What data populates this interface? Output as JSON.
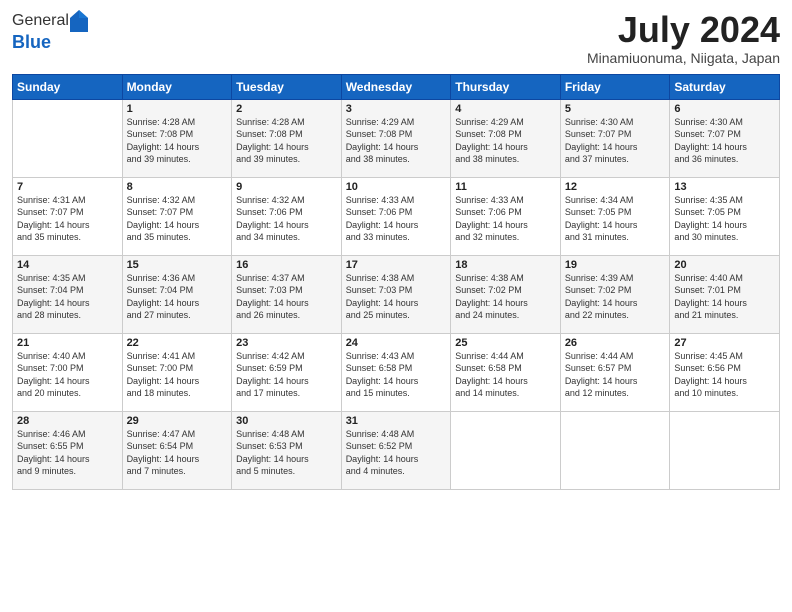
{
  "header": {
    "logo_general": "General",
    "logo_blue": "Blue",
    "month_title": "July 2024",
    "location": "Minamiuonuma, Niigata, Japan"
  },
  "weekdays": [
    "Sunday",
    "Monday",
    "Tuesday",
    "Wednesday",
    "Thursday",
    "Friday",
    "Saturday"
  ],
  "weeks": [
    [
      {
        "day": "",
        "info": ""
      },
      {
        "day": "1",
        "info": "Sunrise: 4:28 AM\nSunset: 7:08 PM\nDaylight: 14 hours\nand 39 minutes."
      },
      {
        "day": "2",
        "info": "Sunrise: 4:28 AM\nSunset: 7:08 PM\nDaylight: 14 hours\nand 39 minutes."
      },
      {
        "day": "3",
        "info": "Sunrise: 4:29 AM\nSunset: 7:08 PM\nDaylight: 14 hours\nand 38 minutes."
      },
      {
        "day": "4",
        "info": "Sunrise: 4:29 AM\nSunset: 7:08 PM\nDaylight: 14 hours\nand 38 minutes."
      },
      {
        "day": "5",
        "info": "Sunrise: 4:30 AM\nSunset: 7:07 PM\nDaylight: 14 hours\nand 37 minutes."
      },
      {
        "day": "6",
        "info": "Sunrise: 4:30 AM\nSunset: 7:07 PM\nDaylight: 14 hours\nand 36 minutes."
      }
    ],
    [
      {
        "day": "7",
        "info": "Sunrise: 4:31 AM\nSunset: 7:07 PM\nDaylight: 14 hours\nand 35 minutes."
      },
      {
        "day": "8",
        "info": "Sunrise: 4:32 AM\nSunset: 7:07 PM\nDaylight: 14 hours\nand 35 minutes."
      },
      {
        "day": "9",
        "info": "Sunrise: 4:32 AM\nSunset: 7:06 PM\nDaylight: 14 hours\nand 34 minutes."
      },
      {
        "day": "10",
        "info": "Sunrise: 4:33 AM\nSunset: 7:06 PM\nDaylight: 14 hours\nand 33 minutes."
      },
      {
        "day": "11",
        "info": "Sunrise: 4:33 AM\nSunset: 7:06 PM\nDaylight: 14 hours\nand 32 minutes."
      },
      {
        "day": "12",
        "info": "Sunrise: 4:34 AM\nSunset: 7:05 PM\nDaylight: 14 hours\nand 31 minutes."
      },
      {
        "day": "13",
        "info": "Sunrise: 4:35 AM\nSunset: 7:05 PM\nDaylight: 14 hours\nand 30 minutes."
      }
    ],
    [
      {
        "day": "14",
        "info": "Sunrise: 4:35 AM\nSunset: 7:04 PM\nDaylight: 14 hours\nand 28 minutes."
      },
      {
        "day": "15",
        "info": "Sunrise: 4:36 AM\nSunset: 7:04 PM\nDaylight: 14 hours\nand 27 minutes."
      },
      {
        "day": "16",
        "info": "Sunrise: 4:37 AM\nSunset: 7:03 PM\nDaylight: 14 hours\nand 26 minutes."
      },
      {
        "day": "17",
        "info": "Sunrise: 4:38 AM\nSunset: 7:03 PM\nDaylight: 14 hours\nand 25 minutes."
      },
      {
        "day": "18",
        "info": "Sunrise: 4:38 AM\nSunset: 7:02 PM\nDaylight: 14 hours\nand 24 minutes."
      },
      {
        "day": "19",
        "info": "Sunrise: 4:39 AM\nSunset: 7:02 PM\nDaylight: 14 hours\nand 22 minutes."
      },
      {
        "day": "20",
        "info": "Sunrise: 4:40 AM\nSunset: 7:01 PM\nDaylight: 14 hours\nand 21 minutes."
      }
    ],
    [
      {
        "day": "21",
        "info": "Sunrise: 4:40 AM\nSunset: 7:00 PM\nDaylight: 14 hours\nand 20 minutes."
      },
      {
        "day": "22",
        "info": "Sunrise: 4:41 AM\nSunset: 7:00 PM\nDaylight: 14 hours\nand 18 minutes."
      },
      {
        "day": "23",
        "info": "Sunrise: 4:42 AM\nSunset: 6:59 PM\nDaylight: 14 hours\nand 17 minutes."
      },
      {
        "day": "24",
        "info": "Sunrise: 4:43 AM\nSunset: 6:58 PM\nDaylight: 14 hours\nand 15 minutes."
      },
      {
        "day": "25",
        "info": "Sunrise: 4:44 AM\nSunset: 6:58 PM\nDaylight: 14 hours\nand 14 minutes."
      },
      {
        "day": "26",
        "info": "Sunrise: 4:44 AM\nSunset: 6:57 PM\nDaylight: 14 hours\nand 12 minutes."
      },
      {
        "day": "27",
        "info": "Sunrise: 4:45 AM\nSunset: 6:56 PM\nDaylight: 14 hours\nand 10 minutes."
      }
    ],
    [
      {
        "day": "28",
        "info": "Sunrise: 4:46 AM\nSunset: 6:55 PM\nDaylight: 14 hours\nand 9 minutes."
      },
      {
        "day": "29",
        "info": "Sunrise: 4:47 AM\nSunset: 6:54 PM\nDaylight: 14 hours\nand 7 minutes."
      },
      {
        "day": "30",
        "info": "Sunrise: 4:48 AM\nSunset: 6:53 PM\nDaylight: 14 hours\nand 5 minutes."
      },
      {
        "day": "31",
        "info": "Sunrise: 4:48 AM\nSunset: 6:52 PM\nDaylight: 14 hours\nand 4 minutes."
      },
      {
        "day": "",
        "info": ""
      },
      {
        "day": "",
        "info": ""
      },
      {
        "day": "",
        "info": ""
      }
    ]
  ]
}
